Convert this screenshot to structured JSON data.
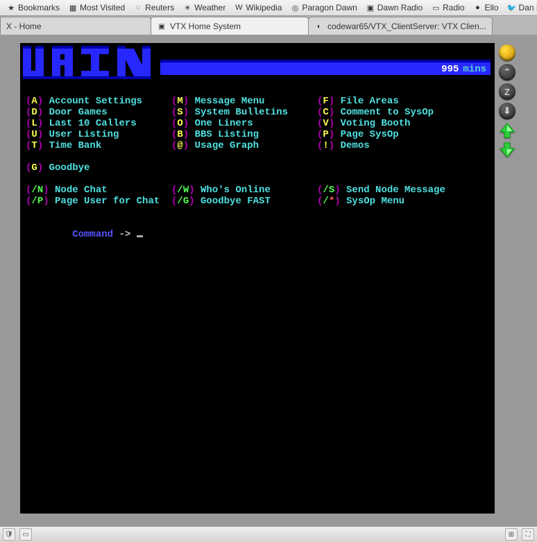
{
  "bookmarks": [
    {
      "label": "Bookmarks",
      "icon": "★"
    },
    {
      "label": "Most Visited",
      "icon": "▦"
    },
    {
      "label": "Reuters",
      "icon": "◌"
    },
    {
      "label": "Weather",
      "icon": "☀"
    },
    {
      "label": "Wikipedia",
      "icon": "W"
    },
    {
      "label": "Paragon Dawn",
      "icon": "◎"
    },
    {
      "label": "Dawn Radio",
      "icon": "▣"
    },
    {
      "label": "Radio",
      "icon": "▭"
    },
    {
      "label": "Ello",
      "icon": "●"
    },
    {
      "label": "Dan Mecklenbur...",
      "icon": "🐦"
    }
  ],
  "tabs": [
    {
      "label": "X - Home",
      "icon": "",
      "active": false,
      "partial": true
    },
    {
      "label": "VTX Home System",
      "icon": "▣",
      "active": true,
      "partial": false
    },
    {
      "label": "codewar65/VTX_ClientServer: VTX Clien...",
      "icon": "◐",
      "active": false,
      "partial": false
    }
  ],
  "header": {
    "title_art": "MAIN",
    "time_value": "995",
    "time_unit": "mins"
  },
  "menu_rows": [
    [
      {
        "key": "A",
        "kc": "kY",
        "label": "Account Settings"
      },
      {
        "key": "M",
        "kc": "kY",
        "label": "Message Menu"
      },
      {
        "key": "F",
        "kc": "kY",
        "label": "File Areas"
      }
    ],
    [
      {
        "key": "D",
        "kc": "kY",
        "label": "Door Games"
      },
      {
        "key": "S",
        "kc": "kY",
        "label": "System Bulletins"
      },
      {
        "key": "C",
        "kc": "kY",
        "label": "Comment to SysOp"
      }
    ],
    [
      {
        "key": "L",
        "kc": "kY",
        "label": "Last 10 Callers"
      },
      {
        "key": "O",
        "kc": "kY",
        "label": "One Liners"
      },
      {
        "key": "V",
        "kc": "kY",
        "label": "Voting Booth"
      }
    ],
    [
      {
        "key": "U",
        "kc": "kY",
        "label": "User Listing"
      },
      {
        "key": "B",
        "kc": "kY",
        "label": "BBS Listing"
      },
      {
        "key": "P",
        "kc": "kY",
        "label": "Page SysOp"
      }
    ],
    [
      {
        "key": "T",
        "kc": "kY",
        "label": "Time Bank"
      },
      {
        "key": "@",
        "kc": "kY",
        "label": "Usage Graph"
      },
      {
        "key": "!",
        "kc": "kY",
        "label": "Demos"
      }
    ]
  ],
  "menu_goodbye": {
    "key": "G",
    "kc": "kY",
    "label": "Goodbye"
  },
  "menu_slash_rows": [
    [
      {
        "key": "/N",
        "kc": "kG",
        "label": "Node Chat"
      },
      {
        "key": "/W",
        "kc": "kG",
        "label": "Who's Online"
      },
      {
        "key": "/S",
        "kc": "kG",
        "label": "Send Node Message"
      }
    ],
    [
      {
        "key": "/P",
        "kc": "kG",
        "label": "Page User for Chat"
      },
      {
        "key": "/G",
        "kc": "kG",
        "label": "Goodbye FAST"
      },
      {
        "key": "/*",
        "kc": "kR",
        "label": "SysOp Menu"
      }
    ]
  ],
  "prompt": {
    "label": "Command",
    "arrow": "->"
  },
  "side_buttons": [
    {
      "name": "bolt-icon",
      "glyph": "⚡",
      "cls": "bolt"
    },
    {
      "name": "caret-up-icon",
      "glyph": "⌃",
      "cls": ""
    },
    {
      "name": "home-z-icon",
      "glyph": "Z",
      "cls": ""
    },
    {
      "name": "download-icon",
      "glyph": "⬇",
      "cls": ""
    },
    {
      "name": "big-up-arrow-icon",
      "glyph": "",
      "cls": "arrow-up"
    },
    {
      "name": "big-down-arrow-icon",
      "glyph": "",
      "cls": "arrow-dn"
    }
  ]
}
